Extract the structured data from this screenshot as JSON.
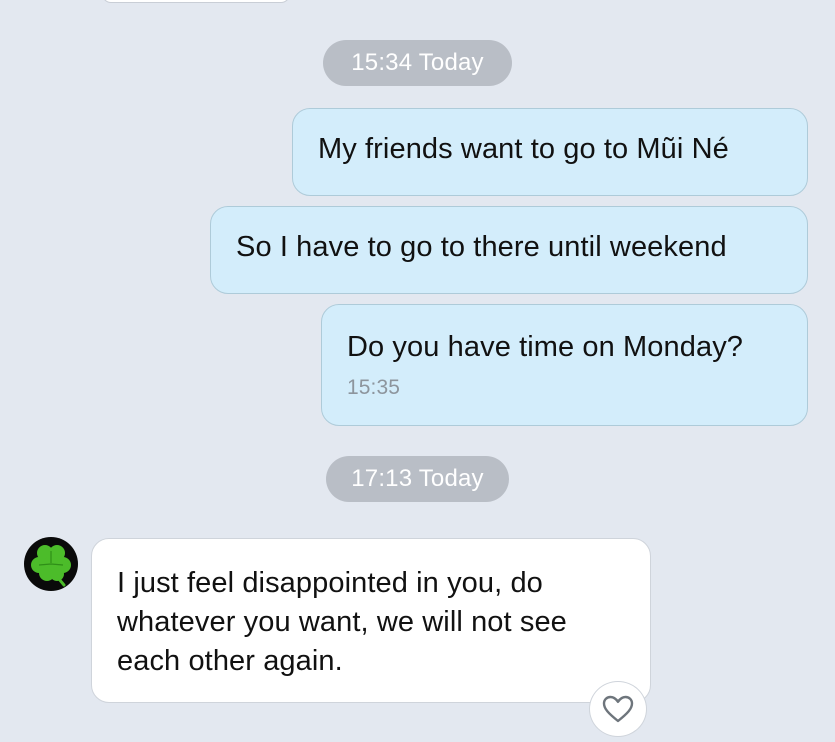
{
  "timestamps": [
    {
      "label": "15:34 Today"
    },
    {
      "label": "17:13 Today"
    }
  ],
  "messages": [
    {
      "direction": "outgoing",
      "text": "My friends want to go to Mũi Né"
    },
    {
      "direction": "outgoing",
      "text": "So I have to go to there until weekend"
    },
    {
      "direction": "outgoing",
      "text": "Do you have time on Monday?",
      "time": "15:35"
    },
    {
      "direction": "incoming",
      "text": "I just feel disappointed in you, do whatever you want, we will not see each other again."
    }
  ],
  "contact": {
    "avatar_icon": "clover-icon",
    "avatar_colors": {
      "background": "#0a0a0a",
      "leaf": "#4cbc2a"
    }
  },
  "reaction": {
    "icon": "heart-icon"
  },
  "colors": {
    "background": "#e3e8f0",
    "outgoing_bubble": "#d3edfb",
    "incoming_bubble": "#ffffff",
    "timestamp_pill": "#b9bec6"
  }
}
